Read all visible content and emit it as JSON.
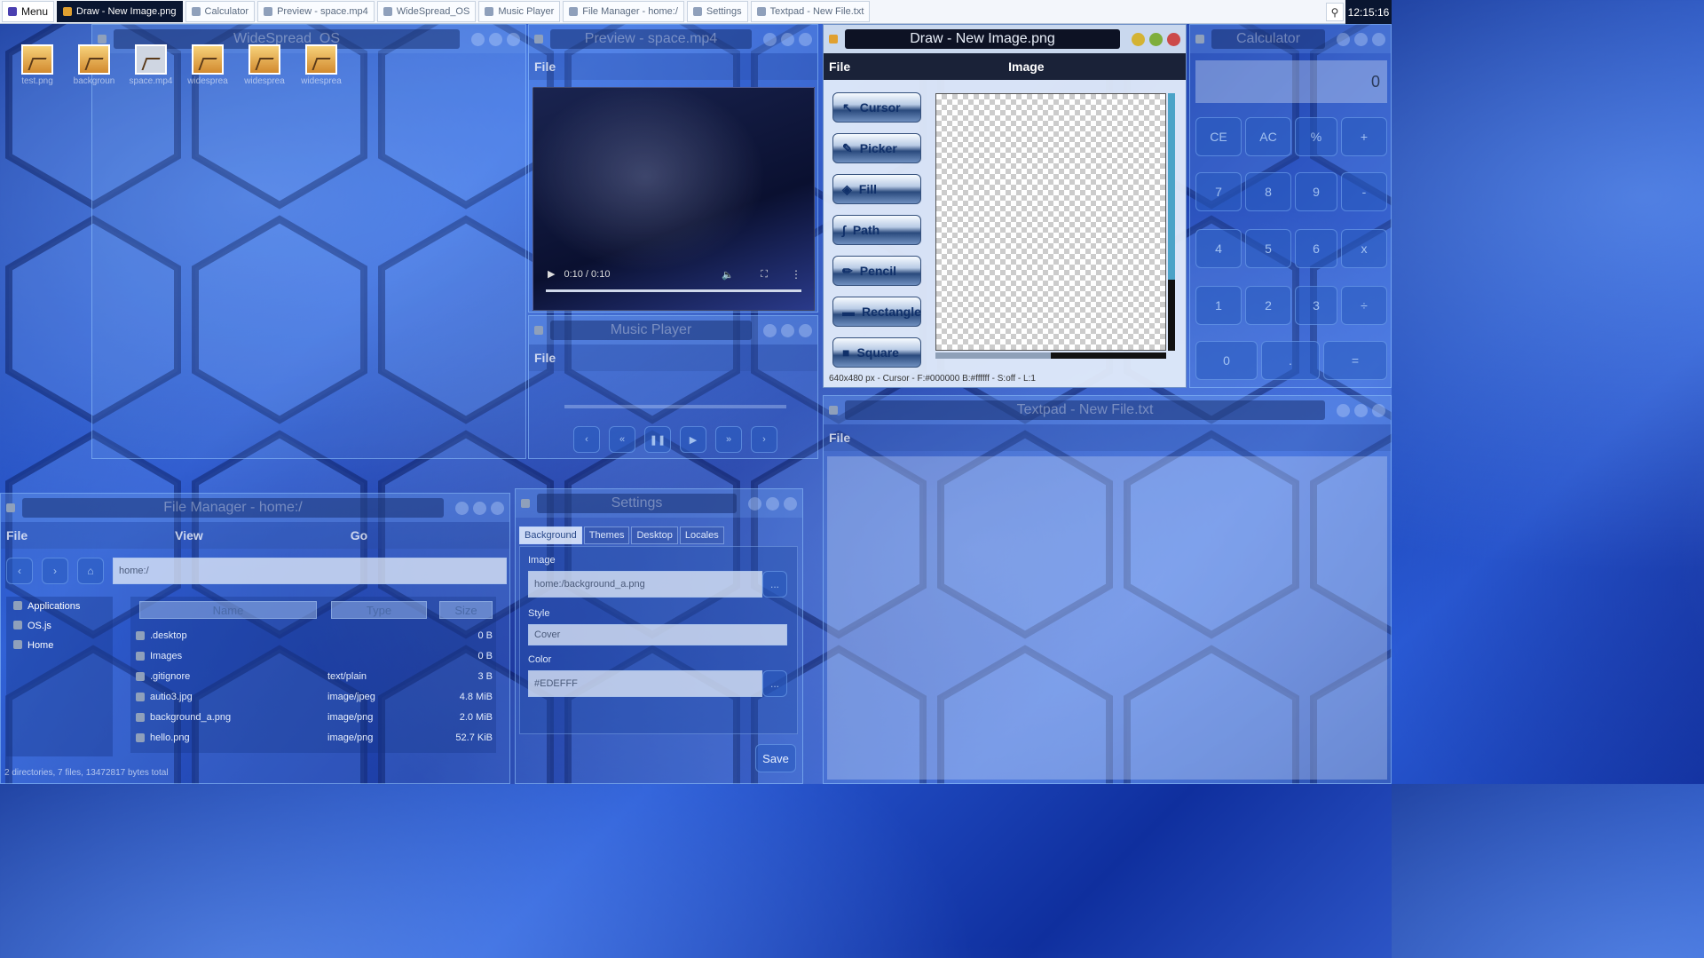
{
  "panel": {
    "menu_label": "Menu",
    "tasks": [
      {
        "label": "Draw - New Image.png",
        "active": true
      },
      {
        "label": "Calculator"
      },
      {
        "label": "Preview - space.mp4"
      },
      {
        "label": "WideSpread_OS"
      },
      {
        "label": "Music Player"
      },
      {
        "label": "File Manager - home:/"
      },
      {
        "label": "Settings"
      },
      {
        "label": "Textpad - New File.txt"
      }
    ],
    "clock": "12:15:16"
  },
  "desktop": {
    "title": "WideSpread_OS",
    "icons": [
      "test.png",
      "backgroun",
      "space.mp4",
      "widesprea",
      "widesprea",
      "widesprea"
    ]
  },
  "preview": {
    "title": "Preview - space.mp4",
    "menu_file": "File",
    "time": "0:10 / 0:10"
  },
  "music": {
    "title": "Music Player",
    "menu_file": "File"
  },
  "draw": {
    "title": "Draw - New Image.png",
    "menu_file": "File",
    "menu_image": "Image",
    "tools": [
      "Cursor",
      "Picker",
      "Fill",
      "Path",
      "Pencil",
      "Rectangle",
      "Square"
    ],
    "status": "640x480 px - Cursor - F:#000000 B:#ffffff - S:off - L:1"
  },
  "calculator": {
    "title": "Calculator",
    "display": "0",
    "keys": [
      "CE",
      "AC",
      "%",
      "+",
      "7",
      "8",
      "9",
      "-",
      "4",
      "5",
      "6",
      "x",
      "1",
      "2",
      "3",
      "÷",
      "0",
      ".",
      "="
    ]
  },
  "textpad": {
    "title": "Textpad - New File.txt",
    "menu_file": "File"
  },
  "filemanager": {
    "title": "File Manager - home:/",
    "menu": [
      "File",
      "View",
      "Go"
    ],
    "path": "home:/",
    "places": [
      "Applications",
      "OS.js",
      "Home"
    ],
    "columns": [
      "Name",
      "Type",
      "Size"
    ],
    "rows": [
      {
        "name": ".desktop",
        "type": "",
        "size": "0 B"
      },
      {
        "name": "Images",
        "type": "",
        "size": "0 B"
      },
      {
        "name": ".gitignore",
        "type": "text/plain",
        "size": "3 B"
      },
      {
        "name": "autio3.jpg",
        "type": "image/jpeg",
        "size": "4.8 MiB"
      },
      {
        "name": "background_a.png",
        "type": "image/png",
        "size": "2.0 MiB"
      },
      {
        "name": "hello.png",
        "type": "image/png",
        "size": "52.7 KiB"
      }
    ],
    "status": "2 directories, 7 files, 13472817 bytes total"
  },
  "settings": {
    "title": "Settings",
    "tabs": [
      "Background",
      "Themes",
      "Desktop",
      "Locales"
    ],
    "image_label": "Image",
    "image_value": "home:/background_a.png",
    "style_label": "Style",
    "style_value": "Cover",
    "color_label": "Color",
    "color_value": "#EDEFFF",
    "browse": "...",
    "save": "Save"
  }
}
